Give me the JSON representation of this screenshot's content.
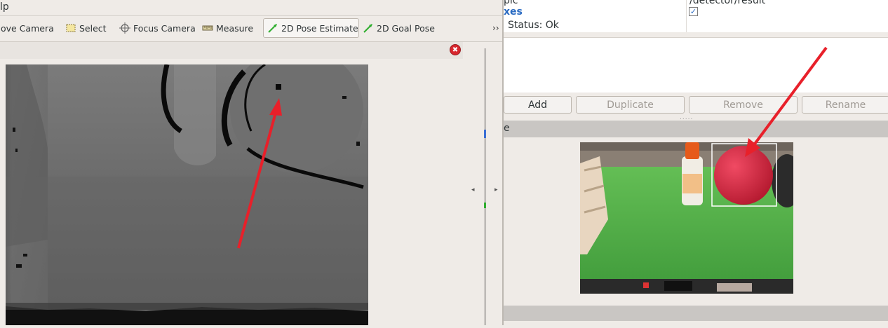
{
  "menubar": {
    "help_label": "lp"
  },
  "toolbar": {
    "tools": [
      {
        "label": "ove Camera",
        "icon": "move-camera-icon"
      },
      {
        "label": "Select",
        "icon": "select-icon"
      },
      {
        "label": "Focus Camera",
        "icon": "focus-camera-icon"
      },
      {
        "label": "Measure",
        "icon": "measure-icon"
      },
      {
        "label": "2D Pose Estimate",
        "icon": "pose-arrow-icon",
        "active": true
      },
      {
        "label": "2D Goal Pose",
        "icon": "goal-arrow-icon"
      }
    ],
    "more_label": "››"
  },
  "depth_panel": {
    "close_label": "✖"
  },
  "properties": {
    "row1_name": "pic",
    "row1_value": "/detector/result",
    "row2_name": "xes",
    "row3_name": "Status: Ok"
  },
  "buttons": {
    "add": "Add",
    "duplicate": "Duplicate",
    "remove": "Remove",
    "rename": "Rename"
  },
  "image_panel": {
    "header_label": "e"
  },
  "colors": {
    "accent_blue": "#2a6bc2",
    "annotation_red": "#e8202a",
    "floor_green": "#5ec44a",
    "ball_red": "#d3263f"
  }
}
